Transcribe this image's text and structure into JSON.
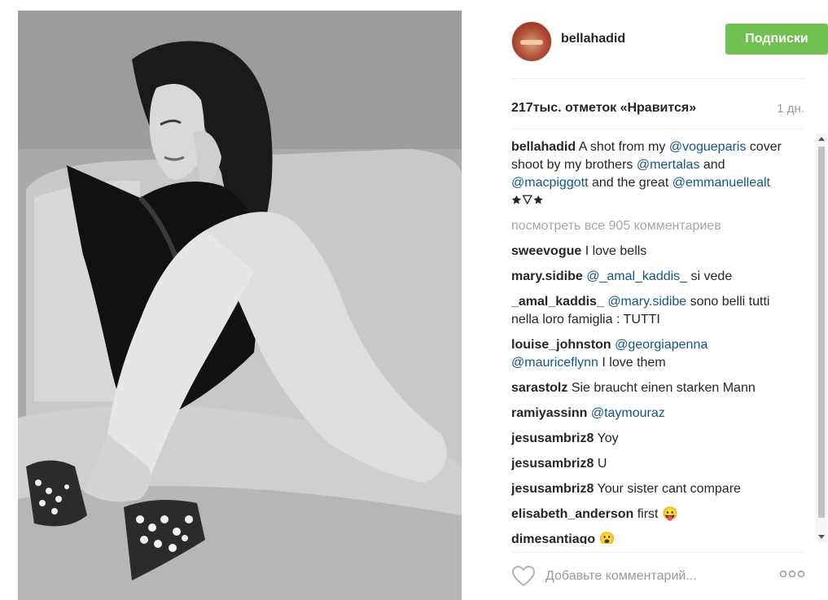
{
  "post": {
    "image_icon": "photo-black-white-model-on-sofa"
  },
  "header": {
    "username": "bellahadid",
    "follow_label": "Подписки",
    "follow_color": "#70c050"
  },
  "stats": {
    "likes": "217тыс. отметок «Нравится»",
    "time": "1 дн."
  },
  "caption": {
    "user": "bellahadid",
    "parts": [
      {
        "text": "A shot from my ",
        "mention": false
      },
      {
        "text": "@vogueparis",
        "mention": true
      },
      {
        "text": " cover shoot by my brothers ",
        "mention": false
      },
      {
        "text": "@mertalas",
        "mention": true
      },
      {
        "text": " and ",
        "mention": false
      },
      {
        "text": "@macpiggott",
        "mention": true
      },
      {
        "text": " and the great ",
        "mention": false
      },
      {
        "text": "@emmanuellealt",
        "mention": true
      },
      {
        "text": " 🟊🜄🟊",
        "mention": false
      }
    ]
  },
  "view_all": "посмотреть все 905 комментариев",
  "comments": [
    {
      "user": "sweevogue",
      "parts": [
        {
          "text": " I love bells",
          "mention": false
        }
      ]
    },
    {
      "user": "mary.sidibe",
      "parts": [
        {
          "text": " ",
          "mention": false
        },
        {
          "text": "@_amal_kaddis_",
          "mention": true
        },
        {
          "text": " si vede",
          "mention": false
        }
      ]
    },
    {
      "user": "_amal_kaddis_",
      "parts": [
        {
          "text": " ",
          "mention": false
        },
        {
          "text": "@mary.sidibe",
          "mention": true
        },
        {
          "text": " sono belli tutti nella loro famiglia : TUTTI",
          "mention": false
        }
      ]
    },
    {
      "user": "louise_johnston",
      "parts": [
        {
          "text": " ",
          "mention": false
        },
        {
          "text": "@georgiapenna",
          "mention": true
        },
        {
          "text": " ",
          "mention": false
        },
        {
          "text": "@mauriceflynn",
          "mention": true
        },
        {
          "text": " I love them",
          "mention": false
        }
      ]
    },
    {
      "user": "sarastolz",
      "parts": [
        {
          "text": " Sie braucht einen starken Mann",
          "mention": false
        }
      ]
    },
    {
      "user": "ramiyassinn",
      "parts": [
        {
          "text": " ",
          "mention": false
        },
        {
          "text": "@taymouraz",
          "mention": true
        }
      ]
    },
    {
      "user": "jesusambriz8",
      "parts": [
        {
          "text": " Yoy",
          "mention": false
        }
      ]
    },
    {
      "user": "jesusambriz8",
      "parts": [
        {
          "text": " U",
          "mention": false
        }
      ]
    },
    {
      "user": "jesusambriz8",
      "parts": [
        {
          "text": " Your sister cant compare",
          "mention": false
        }
      ]
    },
    {
      "user": "elisabeth_anderson",
      "parts": [
        {
          "text": " first 😛",
          "mention": false
        }
      ]
    },
    {
      "user": "dimesantiago",
      "parts": [
        {
          "text": " 😮",
          "mention": false
        }
      ]
    }
  ],
  "footer": {
    "comment_placeholder": "Добавьте комментарий...",
    "like_icon": "heart-outline-icon",
    "more_icon": "more-options-icon"
  },
  "colors": {
    "mention": "#125688",
    "muted": "#a5a7aa"
  }
}
